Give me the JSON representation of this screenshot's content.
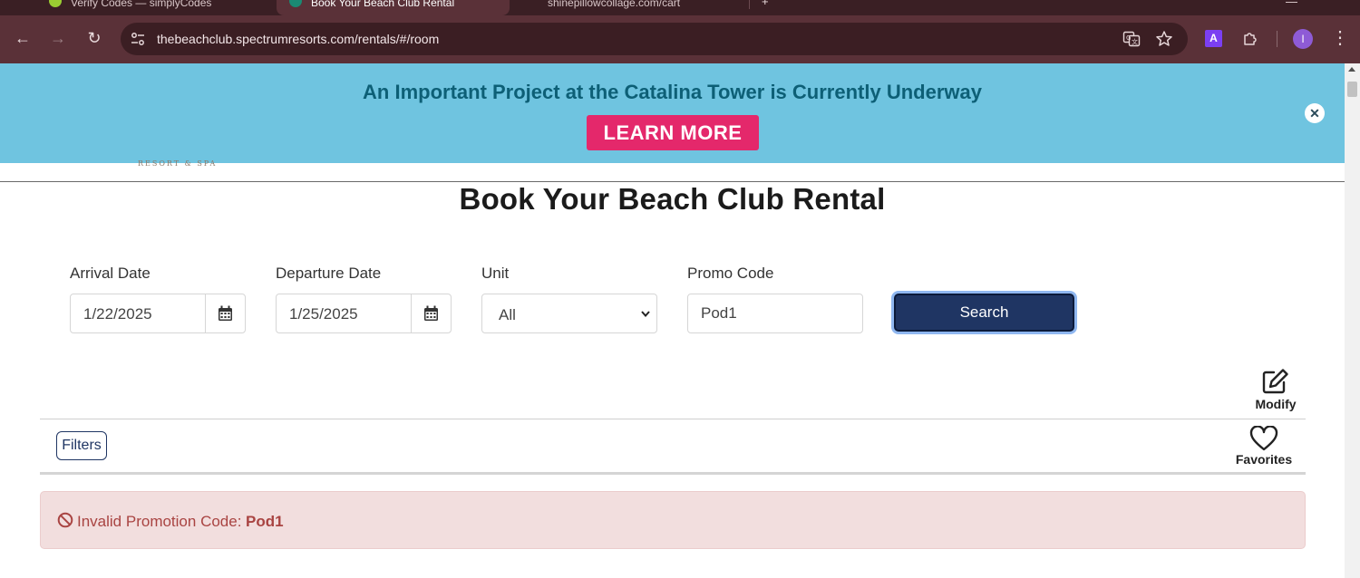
{
  "browser": {
    "tabs": [
      {
        "title": "Verify Codes — simplyCodes",
        "active": false
      },
      {
        "title": "Book Your Beach Club Rental",
        "active": true
      },
      {
        "title": "shinepillowcollage.com/cart",
        "active": false
      }
    ],
    "url": "thebeachclub.spectrumresorts.com/rentals/#/room",
    "profile_initial": "I",
    "extension_letter": "A"
  },
  "banner": {
    "title": "An Important Project at the Catalina Tower is Currently Underway",
    "button_label": "LEARN MORE",
    "close_glyph": "✕"
  },
  "logo_tagline": "RESORT & SPA",
  "page_title": "Book Your Beach Club Rental",
  "search_form": {
    "arrival": {
      "label": "Arrival Date",
      "value": "1/22/2025"
    },
    "departure": {
      "label": "Departure Date",
      "value": "1/25/2025"
    },
    "unit": {
      "label": "Unit",
      "value": "All"
    },
    "promo": {
      "label": "Promo Code",
      "value": "Pod1"
    },
    "search_label": "Search"
  },
  "actions": {
    "modify_label": "Modify",
    "filters_label": "Filters",
    "favorites_label": "Favorites"
  },
  "alert": {
    "message": "Invalid Promotion Code:",
    "code": "Pod1"
  },
  "colors": {
    "banner_bg": "#6fc4e0",
    "banner_text": "#0d5f76",
    "learn_more_bg": "#e4286b",
    "primary": "#1f3563",
    "alert_bg": "#f2dede",
    "alert_text": "#a94442"
  },
  "icons": {
    "arrival_calendar": "calendar-icon",
    "departure_calendar": "calendar-icon",
    "unit_dropdown": "chevron-down-icon",
    "modify": "edit-icon",
    "favorites": "heart-icon",
    "alert": "ban-icon"
  }
}
